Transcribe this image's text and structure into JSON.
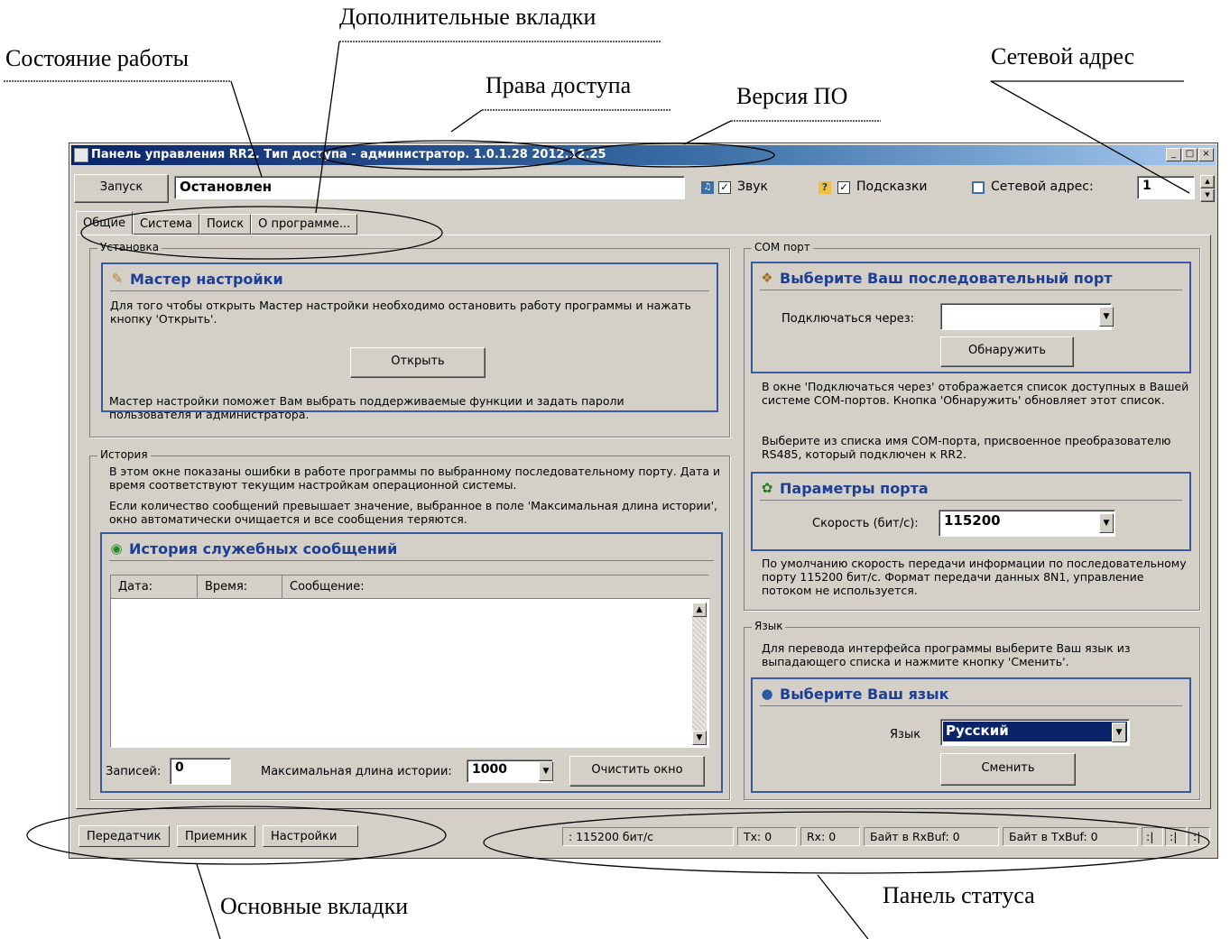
{
  "annotations": {
    "work_state": "Состояние работы",
    "extra_tabs": "Дополнительные вкладки",
    "access_rights": "Права доступа",
    "sw_version": "Версия ПО",
    "net_address": "Сетевой адрес",
    "main_tabs": "Основные вкладки",
    "status_panel": "Панель статуса"
  },
  "window": {
    "title": "Панель управления RR2. Тип доступа - администратор. 1.0.1.28 2012.12.25",
    "minimize": "_",
    "maximize": "□",
    "close": "×"
  },
  "toolbar": {
    "start_button": "Запуск",
    "state_value": "Остановлен",
    "sound_label": "Звук",
    "hints_label": "Подсказки",
    "net_address_label": "Сетевой адрес:",
    "net_address_value": "1"
  },
  "tabs": [
    "Общие",
    "Система",
    "Поиск",
    "О программе..."
  ],
  "install": {
    "legend": "Установка",
    "panel_title": "Мастер настройки",
    "panel_text": "Для того чтобы открыть Мастер настройки необходимо остановить работу программы и нажать кнопку 'Открыть'.",
    "open_button": "Открыть",
    "note": "Мастер настройки поможет Вам выбрать поддерживаемые функции и задать пароли пользователя и администратора."
  },
  "history": {
    "legend": "История",
    "text1": "В этом окне показаны ошибки в работе программы по выбранному последовательному порту. Дата и время соответствуют текущим настройкам операционной системы.",
    "text2": "Если количество сообщений превышает значение, выбранное в поле 'Максимальная длина истории', окно автоматически очищается и все сообщения теряются.",
    "panel_title": "История служебных сообщений",
    "col_date": "Дата:",
    "col_time": "Время:",
    "col_message": "Сообщение:",
    "records_label": "Записей:",
    "records_value": "0",
    "max_len_label": "Максимальная длина истории:",
    "max_len_value": "1000",
    "clear_button": "Очистить окно"
  },
  "com": {
    "legend": "COM порт",
    "panel_title": "Выберите Ваш последовательный порт",
    "connect_label": "Подключаться через:",
    "connect_value": "",
    "detect_button": "Обнаружить",
    "text1": "В окне 'Подключаться через' отображается список доступных в Вашей системе COM-портов. Кнопка 'Обнаружить' обновляет этот список.",
    "text2": "Выберите из списка имя COM-порта, присвоенное преобразователю RS485, который подключен к RR2.",
    "params_title": "Параметры порта",
    "speed_label": "Скорость (бит/с):",
    "speed_value": "115200",
    "text3": "По умолчанию скорость передачи информации по последовательному порту 115200 бит/с. Формат передачи данных 8N1, управление потоком не используется."
  },
  "lang": {
    "legend": "Язык",
    "text": "Для перевода интерфейса программы выберите Ваш язык из выпадающего списка и нажмите кнопку 'Сменить'.",
    "panel_title": "Выберите Ваш язык",
    "lang_label": "Язык",
    "lang_value": "Русский",
    "change_button": "Сменить"
  },
  "bottom_tabs": [
    "Передатчик",
    "Приемник",
    "Настройки"
  ],
  "status": {
    "speed": ": 115200 бит/с",
    "tx": "Tx: 0",
    "rx": "Rx: 0",
    "rxbuf": "Байт в RxBuf: 0",
    "txbuf": "Байт в TxBuf: 0",
    "ind1": ":|",
    "ind2": ":|",
    "ind3": ":|"
  }
}
